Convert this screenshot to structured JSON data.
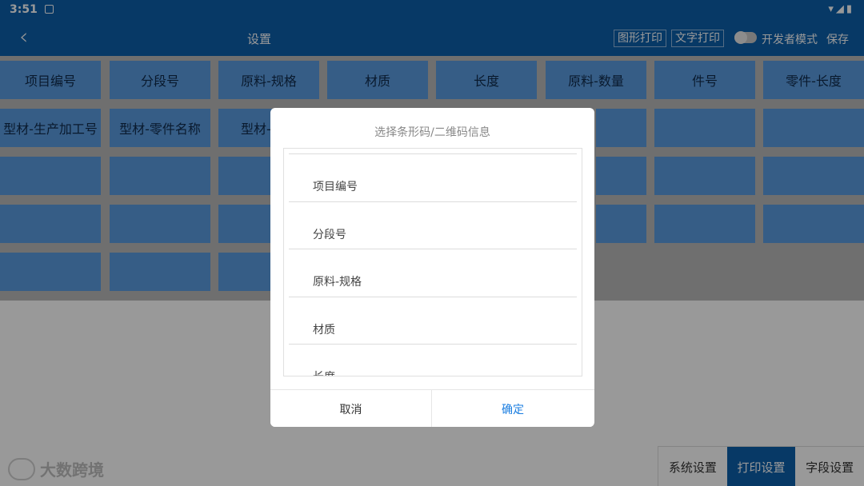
{
  "status": {
    "time": "3:51",
    "icons": "▾◢▮"
  },
  "appbar": {
    "back_glyph": "‹",
    "title": "设置",
    "graphic_print": "图形打印",
    "text_print": "文字打印",
    "dev_mode": "开发者模式",
    "save": "保存"
  },
  "grid": {
    "row1": [
      "项目编号",
      "分段号",
      "原料-规格",
      "材质",
      "长度",
      "原料-数量",
      "件号",
      "零件-长度"
    ],
    "row2": [
      "型材-生产加工号",
      "型材-零件名称",
      "型材-"
    ]
  },
  "dialog": {
    "title": "选择条形码/二维码信息",
    "items": [
      "项目编号",
      "分段号",
      "原料-规格",
      "材质",
      "长度"
    ],
    "cancel": "取消",
    "ok": "确定"
  },
  "tabs": [
    "系统设置",
    "打印设置",
    "字段设置"
  ],
  "watermark": "大数跨境"
}
